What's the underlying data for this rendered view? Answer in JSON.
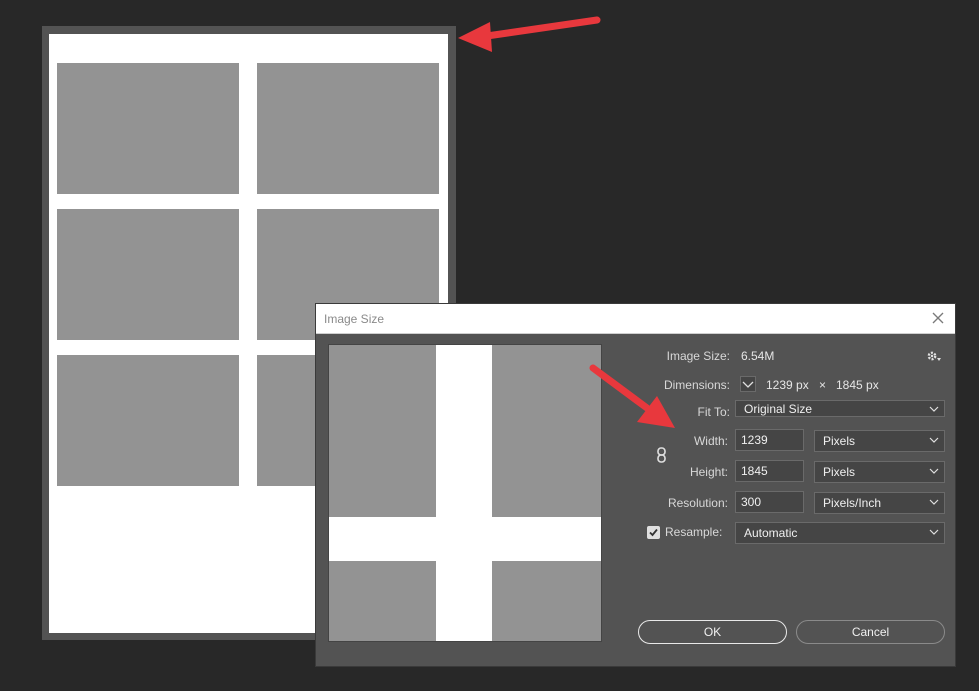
{
  "dialog": {
    "title": "Image Size",
    "image_size_label": "Image Size:",
    "image_size_value": "6.54M",
    "dimensions_label": "Dimensions:",
    "dimensions_width": "1239 px",
    "dimensions_times": "×",
    "dimensions_height": "1845 px",
    "fit_to_label": "Fit To:",
    "fit_to_value": "Original Size",
    "width_label": "Width:",
    "width_value": "1239",
    "width_unit": "Pixels",
    "height_label": "Height:",
    "height_value": "1845",
    "height_unit": "Pixels",
    "resolution_label": "Resolution:",
    "resolution_value": "300",
    "resolution_unit": "Pixels/Inch",
    "resample_label": "Resample:",
    "resample_checked": true,
    "resample_value": "Automatic",
    "ok_label": "OK",
    "cancel_label": "Cancel"
  },
  "icons": {
    "close": "close-icon",
    "settings": "gear-icon",
    "link": "chain-link-icon",
    "dimensions_toggle": "chevron-down-icon",
    "annotation": "red-arrow-icon"
  },
  "colors": {
    "app_background": "#282828",
    "dialog_background": "#535353",
    "photo_placeholder": "#939393",
    "annotation_arrow": "#e8383d"
  }
}
